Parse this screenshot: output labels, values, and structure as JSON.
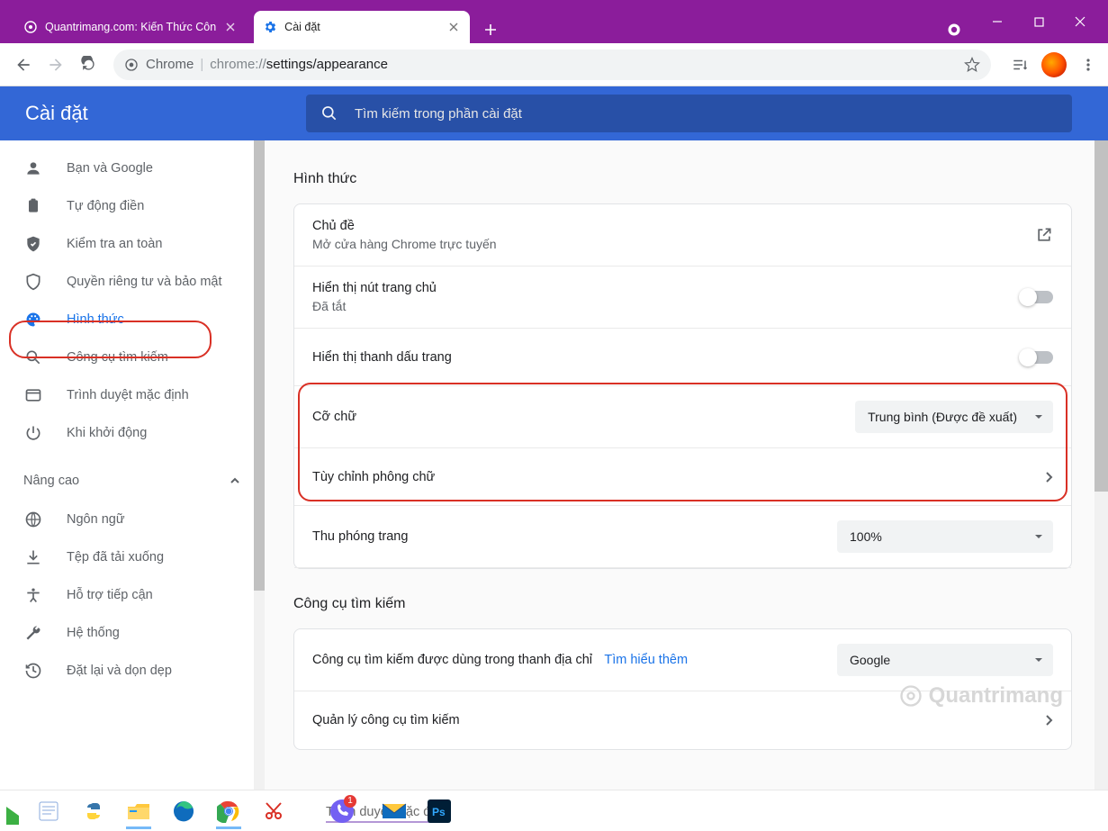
{
  "window": {
    "tabs": [
      {
        "title": "Quantrimang.com: Kiến Thức Côn",
        "active": false
      },
      {
        "title": "Cài đặt",
        "active": true
      }
    ]
  },
  "omnibox": {
    "chrome_label": "Chrome",
    "scheme": "chrome://",
    "path_grey1": "settings/",
    "path_dark": "appearance"
  },
  "settings": {
    "title": "Cài đặt",
    "search_placeholder": "Tìm kiếm trong phần cài đặt"
  },
  "sidebar": {
    "items": [
      {
        "icon": "person",
        "label": "Bạn và Google"
      },
      {
        "icon": "autofill",
        "label": "Tự động điền"
      },
      {
        "icon": "shield-check",
        "label": "Kiểm tra an toàn"
      },
      {
        "icon": "shield",
        "label": "Quyền riêng tư và bảo mật"
      },
      {
        "icon": "palette",
        "label": "Hình thức",
        "active": true
      },
      {
        "icon": "search",
        "label": "Công cụ tìm kiếm"
      },
      {
        "icon": "browser",
        "label": "Trình duyệt mặc định"
      },
      {
        "icon": "power",
        "label": "Khi khởi động"
      }
    ],
    "advanced_label": "Nâng cao",
    "advanced_items": [
      {
        "icon": "globe",
        "label": "Ngôn ngữ"
      },
      {
        "icon": "download",
        "label": "Tệp đã tải xuống"
      },
      {
        "icon": "accessibility",
        "label": "Hỗ trợ tiếp cận"
      },
      {
        "icon": "wrench",
        "label": "Hệ thống"
      },
      {
        "icon": "reset",
        "label": "Đặt lại và dọn dẹp"
      }
    ]
  },
  "appearance": {
    "section_title": "Hình thức",
    "theme": {
      "title": "Chủ đề",
      "subtitle": "Mở cửa hàng Chrome trực tuyến"
    },
    "home_button": {
      "title": "Hiển thị nút trang chủ",
      "status": "Đã tắt"
    },
    "bookmarks_bar": {
      "title": "Hiển thị thanh dấu trang"
    },
    "font_size": {
      "title": "Cỡ chữ",
      "value": "Trung bình (Được đề xuất)"
    },
    "custom_fonts": {
      "title": "Tùy chỉnh phông chữ"
    },
    "zoom": {
      "title": "Thu phóng trang",
      "value": "100%"
    }
  },
  "search_engine": {
    "section_title": "Công cụ tìm kiếm",
    "used_in_bar": "Công cụ tìm kiếm được dùng trong thanh địa chỉ",
    "learn_more": "Tìm hiểu thêm",
    "value": "Google",
    "manage": "Quản lý công cụ tìm kiếm"
  },
  "default_browser": {
    "section_title": "Trình duyệt mặc định"
  },
  "watermark": "Quantrimang",
  "taskbar": {
    "caption": "Trình duyệt mặc định",
    "viber_badge": "1"
  }
}
